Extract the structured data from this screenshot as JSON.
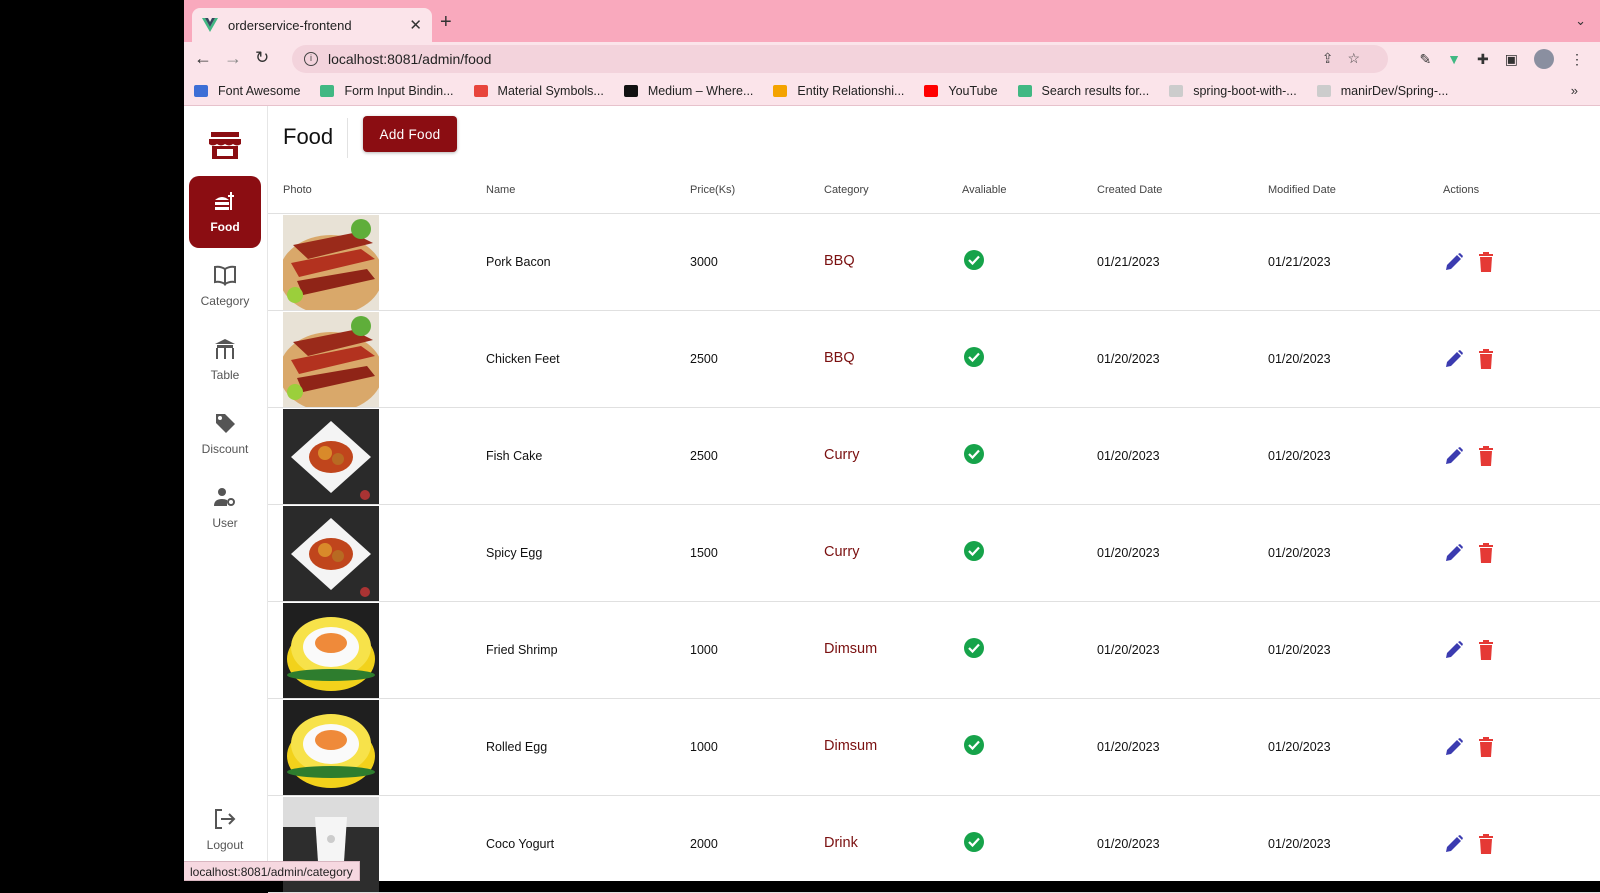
{
  "browser": {
    "tab_title": "orderservice-frontend",
    "url": "localhost:8081/admin/food",
    "bookmarks": [
      {
        "label": "Font Awesome",
        "color": "#3d6fd6"
      },
      {
        "label": "Form Input Bindin...",
        "color": "#41b883"
      },
      {
        "label": "Material Symbols...",
        "color": "#e8453c"
      },
      {
        "label": "Medium – Where...",
        "color": "#111111"
      },
      {
        "label": "Entity Relationshi...",
        "color": "#f4a300"
      },
      {
        "label": "YouTube",
        "color": "#ff0000"
      },
      {
        "label": "Search results for...",
        "color": "#41b883"
      },
      {
        "label": "spring-boot-with-...",
        "color": "#cccccc"
      },
      {
        "label": "manirDev/Spring-...",
        "color": "#cccccc"
      }
    ],
    "status_url": "localhost:8081/admin/category"
  },
  "sidebar": {
    "items": [
      {
        "label": "Food",
        "icon": "fastfood-icon",
        "active": true
      },
      {
        "label": "Category",
        "icon": "menu-book-icon",
        "active": false
      },
      {
        "label": "Table",
        "icon": "table-restaurant-icon",
        "active": false
      },
      {
        "label": "Discount",
        "icon": "tag-icon",
        "active": false
      },
      {
        "label": "User",
        "icon": "manage-accounts-icon",
        "active": false
      }
    ],
    "logout_label": "Logout"
  },
  "header": {
    "title": "Food",
    "add_button": "Add Food"
  },
  "table": {
    "columns": [
      "Photo",
      "Name",
      "Price(Ks)",
      "Category",
      "Avaliable",
      "Created Date",
      "Modified Date",
      "Actions"
    ],
    "rows": [
      {
        "name": "Pork Bacon",
        "price": "3000",
        "category": "BBQ",
        "available": true,
        "created": "01/21/2023",
        "modified": "01/21/2023",
        "photo": "bbq"
      },
      {
        "name": "Chicken Feet",
        "price": "2500",
        "category": "BBQ",
        "available": true,
        "created": "01/20/2023",
        "modified": "01/20/2023",
        "photo": "bbq"
      },
      {
        "name": "Fish Cake",
        "price": "2500",
        "category": "Curry",
        "available": true,
        "created": "01/20/2023",
        "modified": "01/20/2023",
        "photo": "curry"
      },
      {
        "name": "Spicy Egg",
        "price": "1500",
        "category": "Curry",
        "available": true,
        "created": "01/20/2023",
        "modified": "01/20/2023",
        "photo": "curry"
      },
      {
        "name": "Fried Shrimp",
        "price": "1000",
        "category": "Dimsum",
        "available": true,
        "created": "01/20/2023",
        "modified": "01/20/2023",
        "photo": "dimsum"
      },
      {
        "name": "Rolled Egg",
        "price": "1000",
        "category": "Dimsum",
        "available": true,
        "created": "01/20/2023",
        "modified": "01/20/2023",
        "photo": "dimsum"
      },
      {
        "name": "Coco Yogurt",
        "price": "2000",
        "category": "Drink",
        "available": true,
        "created": "01/20/2023",
        "modified": "01/20/2023",
        "photo": "drink"
      }
    ]
  },
  "colors": {
    "brand": "#8b0d12",
    "available_check": "#16a34a",
    "edit_icon": "#3b3bb0",
    "delete_icon": "#e53935"
  }
}
